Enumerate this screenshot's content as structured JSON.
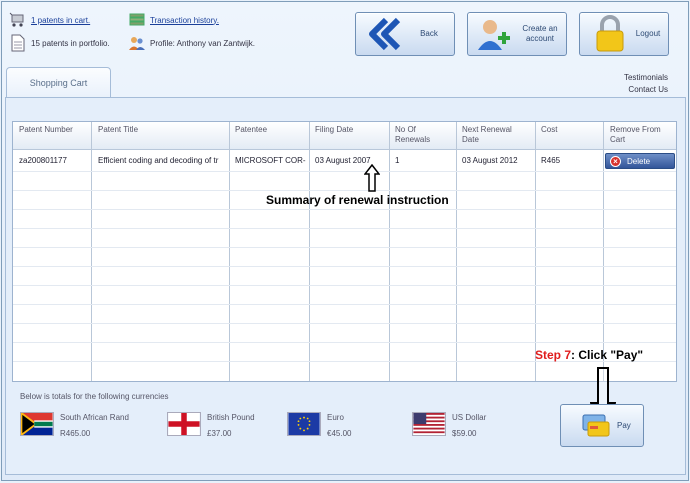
{
  "header": {
    "cart_link": "1 patents in cart.",
    "portfolio_text": "15 patents in portfolio.",
    "transaction_link": "Transaction history.",
    "profile_text": "Profile: Anthony van Zantwijk."
  },
  "buttons": {
    "back": "Back",
    "create_account_line1": "Create an",
    "create_account_line2": "account",
    "logout": "Logout",
    "pay": "Pay",
    "delete": "Delete"
  },
  "tab": {
    "label": "Shopping Cart"
  },
  "links": {
    "testimonials": "Testimonials",
    "contact": "Contact Us"
  },
  "table": {
    "columns": [
      "Patent Number",
      "Patent Title",
      "Patentee",
      "Filing Date",
      "No Of",
      "Renewals",
      "Next Renewal",
      "Date",
      "Cost",
      "Remove From",
      "Cart"
    ],
    "rows": [
      {
        "patent_number": "za200801177",
        "title": "Efficient coding and decoding of tr",
        "patentee": "MICROSOFT COR-",
        "filing_date": "03 August 2007",
        "renewals": "1",
        "next_renewal": "03 August 2012",
        "cost": "R465"
      }
    ]
  },
  "annotations": {
    "summary": "Summary of renewal instruction",
    "step_label": "Step 7",
    "step_text": ": Click \"Pay\""
  },
  "totals": {
    "heading": "Below is totals for the following currencies",
    "currencies": [
      {
        "name": "South African Rand",
        "amount": "R465.00"
      },
      {
        "name": "British Pound",
        "amount": "£37.00"
      },
      {
        "name": "Euro",
        "amount": "€45.00"
      },
      {
        "name": "US Dollar",
        "amount": "$59.00"
      }
    ]
  },
  "colors": {
    "accent": "#33569a",
    "annotation_red": "#e01d1d",
    "panel": "#e4eefa"
  }
}
